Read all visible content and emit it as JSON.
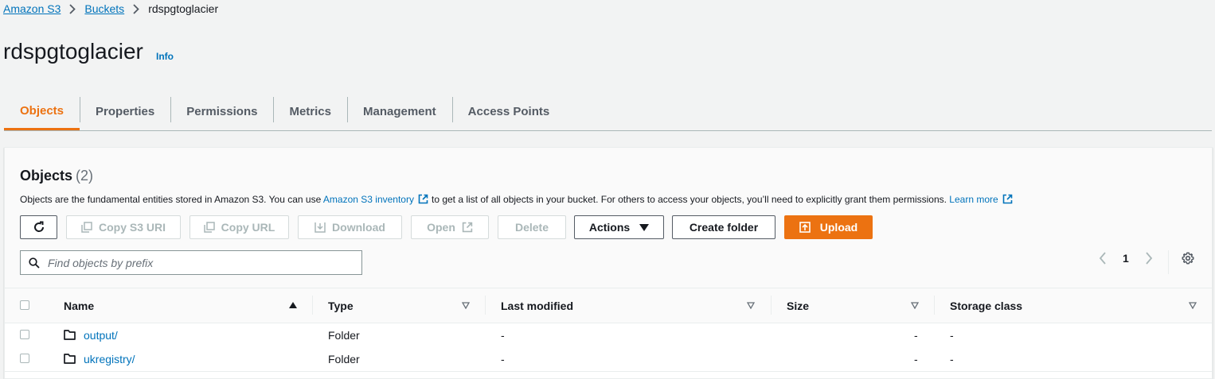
{
  "breadcrumb": {
    "items": [
      "Amazon S3",
      "Buckets"
    ],
    "current": "rdspgtoglacier"
  },
  "page": {
    "title": "rdspgtoglacier",
    "info": "Info"
  },
  "tabs": [
    "Objects",
    "Properties",
    "Permissions",
    "Metrics",
    "Management",
    "Access Points"
  ],
  "active_tab": "Objects",
  "objects": {
    "title": "Objects",
    "count": "(2)",
    "description_pre": "Objects are the fundamental entities stored in Amazon S3. You can use",
    "description_link": "Amazon S3 inventory",
    "description_post": "to get a list of all objects in your bucket. For others to access your objects, you’ll need to explicitly grant them permissions.",
    "learn_more": "Learn more"
  },
  "toolbar": {
    "copy_s3_uri": "Copy S3 URI",
    "copy_url": "Copy URL",
    "download": "Download",
    "open": "Open",
    "delete": "Delete",
    "actions": "Actions",
    "create_folder": "Create folder",
    "upload": "Upload"
  },
  "search": {
    "placeholder": "Find objects by prefix",
    "value": ""
  },
  "pagination": {
    "page": "1"
  },
  "table": {
    "columns": [
      "Name",
      "Type",
      "Last modified",
      "Size",
      "Storage class"
    ],
    "rows": [
      {
        "name": "output/",
        "type": "Folder",
        "last_modified": "-",
        "size": "-",
        "storage_class": "-"
      },
      {
        "name": "ukregistry/",
        "type": "Folder",
        "last_modified": "-",
        "size": "-",
        "storage_class": "-"
      }
    ]
  },
  "colors": {
    "accent": "#ec7211",
    "link": "#0073bb",
    "text": "#16191f",
    "muted": "#545b64",
    "disabled": "#aab7b8"
  },
  "icons": {
    "refresh": "refresh-icon",
    "copy": "copy-icon",
    "download": "download-icon",
    "external": "external-link-icon",
    "caret": "caret-down-icon",
    "upload": "upload-icon",
    "search": "search-icon",
    "settings": "gear-icon",
    "folder": "folder-icon"
  }
}
